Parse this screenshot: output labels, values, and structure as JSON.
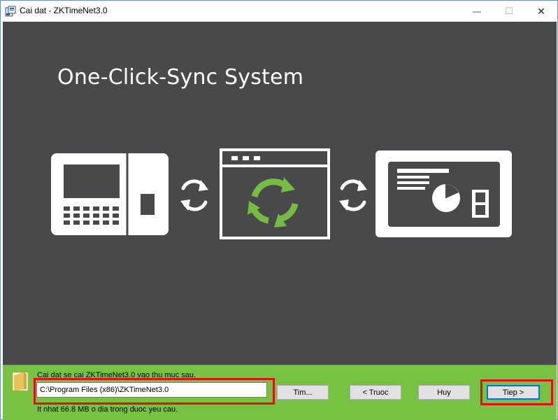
{
  "window": {
    "title": "Cai dat - ZKTimeNet3.0",
    "minimize_symbol": "—",
    "maximize_symbol": "☐",
    "close_symbol": "✕"
  },
  "banner": {
    "title": "One-Click-Sync System",
    "background_color": "#47494a",
    "accent_color": "#76bc43",
    "icons": [
      "time-attendance-device-icon",
      "sync-arrows-icon",
      "software-window-sync-icon",
      "sync-arrows-icon",
      "report-dashboard-icon"
    ]
  },
  "footer": {
    "background_color": "#78c243",
    "message_top": "Cai dat se cai ZKTimeNet3.0 vao thu muc sau.",
    "install_path": "C:\\Program Files (x86)\\ZKTimeNet3.0",
    "message_bottom": "It nhat 66.8 MB o dia trong duoc yeu cau.",
    "browse_label": "Tim...",
    "back_label": "< Truoc",
    "cancel_label": "Huy",
    "next_label": "Tiep >",
    "highlight_color": "#e0101a"
  }
}
